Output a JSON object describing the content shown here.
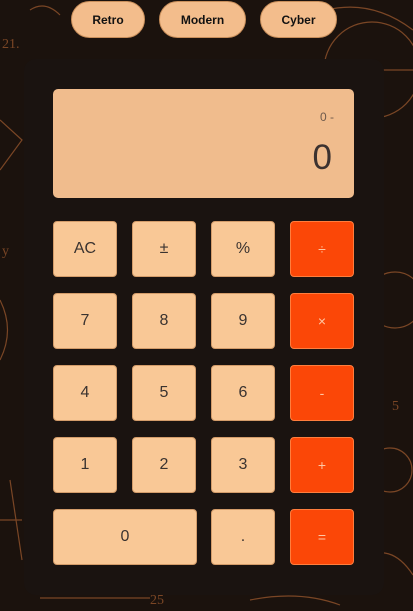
{
  "themes": [
    "Retro",
    "Modern",
    "Cyber"
  ],
  "display": {
    "previous": "0 -",
    "current": "0"
  },
  "keys": {
    "clear": "AC",
    "negate": "±",
    "percent": "%",
    "divide": "÷",
    "seven": "7",
    "eight": "8",
    "nine": "9",
    "multiply": "×",
    "four": "4",
    "five": "5",
    "six": "6",
    "subtract": "-",
    "one": "1",
    "two": "2",
    "three": "3",
    "add": "+",
    "zero": "0",
    "decimal": ".",
    "equals": "="
  },
  "colors": {
    "background": "#1b120d",
    "chalk": "#c9713a",
    "body": "#1a1310",
    "display": "#f0bc8d",
    "key": "#f9c896",
    "operator": "#fb4707",
    "theme_button": "#f3bd8c"
  }
}
